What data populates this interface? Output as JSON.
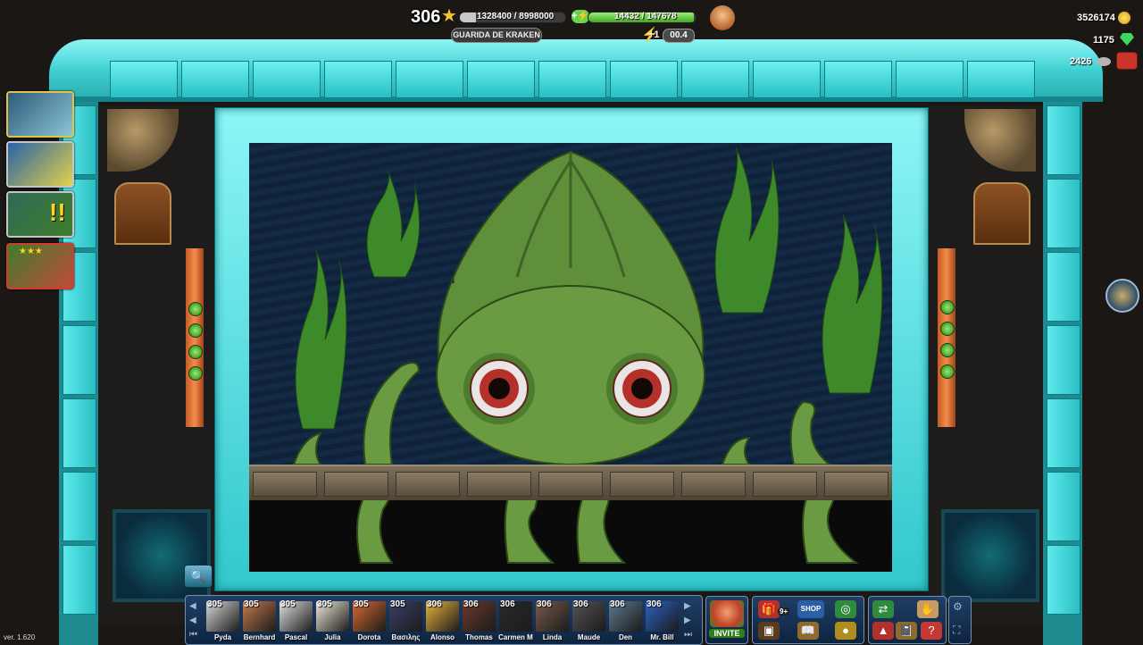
{
  "hud": {
    "level": "306",
    "xp_text": "1328400 / 8998000",
    "xp_fraction": 0.15,
    "energy_text": "14432 / 147678",
    "energy_fraction": 0.98,
    "location": "GUARIDA DE KRAKEN",
    "energy_bonus": "+1",
    "timer": "00.4",
    "coins": "3526174",
    "gems": "1175",
    "materials": "2426"
  },
  "scene": {
    "title": "Kraken lair",
    "colors": {
      "kraken": "#5f8f3a",
      "sea": "#132a45",
      "frame": "#3fd0d2"
    }
  },
  "friends": [
    {
      "level": "305",
      "name": "Pyda"
    },
    {
      "level": "305",
      "name": "Bernhard"
    },
    {
      "level": "305",
      "name": "Pascal"
    },
    {
      "level": "305",
      "name": "Julia"
    },
    {
      "level": "305",
      "name": "Dorota"
    },
    {
      "level": "305",
      "name": "Βασιλης"
    },
    {
      "level": "306",
      "name": "Alonso"
    },
    {
      "level": "306",
      "name": "Thomas"
    },
    {
      "level": "306",
      "name": "Carmen M"
    },
    {
      "level": "306",
      "name": "Linda"
    },
    {
      "level": "306",
      "name": "Maude"
    },
    {
      "level": "306",
      "name": "Den"
    },
    {
      "level": "306",
      "name": "Mr. Bill"
    }
  ],
  "buttons": {
    "invite": "INVITE",
    "shop": "SHOP",
    "gift_count": "9+"
  },
  "version": "ver. 1.620"
}
